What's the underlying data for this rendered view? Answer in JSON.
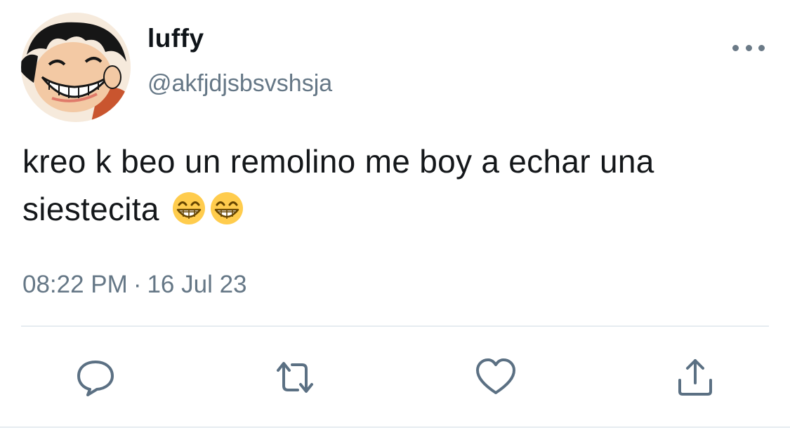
{
  "tweet": {
    "display_name": "luffy",
    "handle": "@akfjdjsbsvshsja",
    "text": "kreo k beo un remolino me boy a echar una siestecita",
    "emojis": [
      "grinning-face-with-smiling-eyes",
      "grinning-face-with-smiling-eyes"
    ],
    "time": "08:22 PM",
    "separator": "·",
    "date": "16 Jul 23"
  },
  "actions": [
    "reply-icon",
    "retweet-icon",
    "like-icon",
    "share-icon"
  ],
  "colors": {
    "text": "#14171a",
    "secondary": "#657786",
    "icon": "#5b7083",
    "divider": "#e6ecf0",
    "emoji_face": "#ffcc4d"
  }
}
